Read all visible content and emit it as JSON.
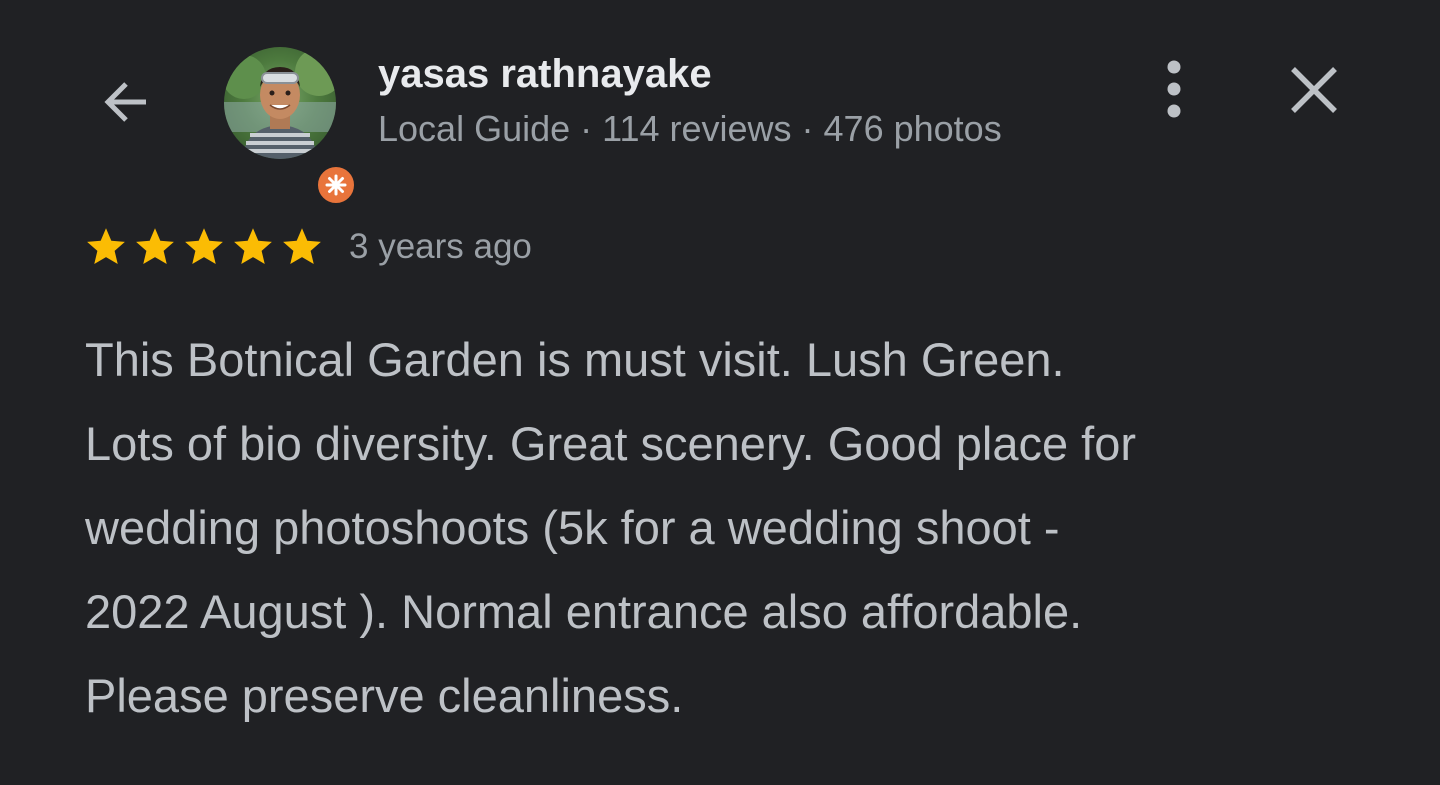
{
  "header": {
    "back_icon": "arrow-back-icon",
    "more_icon": "more-vertical-icon",
    "close_icon": "close-icon"
  },
  "reviewer": {
    "name": "yasas rathnayake",
    "meta": "Local Guide · 114 reviews · 476 photos",
    "avatar_icon": "user-avatar",
    "badge_icon": "local-guide-badge-icon",
    "badge_color": "#e8743b"
  },
  "review": {
    "rating": 5,
    "rating_max": 5,
    "star_color": "#fbbc04",
    "date": "3 years ago",
    "text": "This Botnical Garden is must visit. Lush Green.\nLots of bio diversity. Great scenery. Good place for\nwedding photoshoots (5k for a wedding shoot -\n2022 August ). Normal entrance also affordable.\nPlease preserve cleanliness."
  },
  "colors": {
    "background": "#202124",
    "primary_text": "#e8eaed",
    "secondary_text": "#9aa0a6",
    "body_text": "#bdc1c6"
  }
}
